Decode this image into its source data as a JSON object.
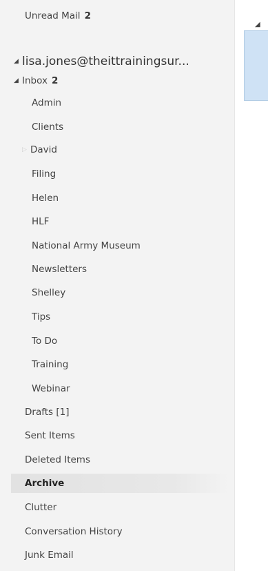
{
  "folder_pane": {
    "unread_mail": {
      "label": "Unread Mail",
      "count": "2"
    },
    "account": {
      "label": "lisa.jones@theittrainingsur..."
    },
    "inbox": {
      "label": "Inbox",
      "count": "2"
    },
    "inbox_subfolders": [
      "Admin",
      "Clients",
      "David",
      "Filing",
      "Helen",
      "HLF",
      "National Army Museum",
      "Newsletters",
      "Shelley",
      "Tips",
      "To Do",
      "Training",
      "Webinar"
    ],
    "folders": [
      "Drafts [1]",
      "Sent Items",
      "Deleted Items",
      "Archive",
      "Clutter",
      "Conversation History",
      "Junk Email"
    ],
    "selected_folder": "Archive"
  },
  "icons": {
    "expand_caret": "expanded-triangle-icon",
    "collapsed_caret": "collapsed-triangle-icon"
  },
  "colors": {
    "pane_bg": "#f3f3f3",
    "selected_bg": "#e2e2e2",
    "reading_pane_accent": "#cfe2f5"
  }
}
